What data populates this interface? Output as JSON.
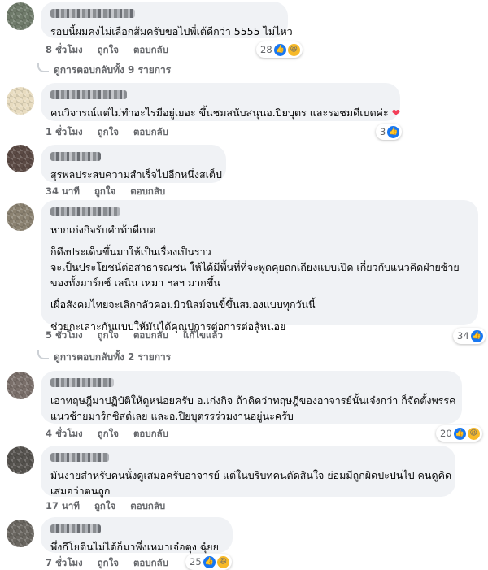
{
  "comments": [
    {
      "lines": [
        "รอบนี้ผมคงไม่เลือกส้มครับขอไปพี่เต้ดีกว่า 5555 ไม่ไหว"
      ],
      "time": "8 ชั่วโมง",
      "like": "ถูกใจ",
      "reply": "ตอบกลับ",
      "edited": "",
      "reaction_count": "28",
      "reactions": [
        "like-icon",
        "haha-icon"
      ],
      "avatar_color": "#6f7b6a"
    },
    {
      "lines": [
        "คนวิจารณ์แต่ไม่ทำอะไรมีอยู่เยอะ ขึ้นชมสนับสนุนอ.ปิยบุตร และรอชมดีเบตค่ะ"
      ],
      "time": "1 ชั่วโมง",
      "like": "ถูกใจ",
      "reply": "ตอบกลับ",
      "edited": "",
      "reaction_count": "3",
      "reactions": [
        "like-icon"
      ],
      "inline_icon": "heart-icon",
      "avatar_color": "#e8dcc0"
    },
    {
      "lines": [
        "สุรพลประสบความสำเร็จไปอีกหนึ่งสเต็ป"
      ],
      "time": "34 นาที",
      "like": "ถูกใจ",
      "reply": "ตอบกลับ",
      "edited": "",
      "reaction_count": "",
      "reactions": [],
      "avatar_color": "#5b4a44"
    },
    {
      "lines": [
        "หากเก่งกิจรับคำท้าดีเบต",
        "",
        "ก็ดึงประเด็นขึ้นมาให้เป็นเรื่องเป็นราว",
        "จะเป็นประโยชน์ต่อสาธารณชน ให้ได้มีพื้นที่ที่จะพูดคุยถกเถียงแบบเปิด เกี่ยวกับแนวคิดฝ่ายซ้าย",
        "ของทั้งมาร์กซ์ เลนิน เหมา ฯลฯ มากขึ้น",
        "",
        "เผื่อสังคมไทยจะเลิกกลัวคอมมิวนิสม์จนขี้ขึ้นสมองแบบทุกวันนี้",
        "",
        "ช่วยกะเลาะกันแบบให้มันได้คุณูปการต่อการต่อสู้หน่อย"
      ],
      "time": "5 ชั่วโมง",
      "like": "ถูกใจ",
      "reply": "ตอบกลับ",
      "edited": "แก้ไขแล้ว",
      "reaction_count": "34",
      "reactions": [
        "like-icon"
      ],
      "avatar_color": "#8a8170"
    },
    {
      "lines": [
        "เอาทฤษฎีมาปฏิบัติให้ดูหน่อยครับ อ.เก่งกิจ ถ้าคิดว่าทฤษฎีของอาจารย์นั้นเจ๋งกว่า ก็จัดตั้งพรรค",
        "แนวซ้ายมาร์กซิสต์เลย และอ.ปิยบุตรรร่วมงานอยู่นะครับ"
      ],
      "time": "4 ชั่วโมง",
      "like": "ถูกใจ",
      "reply": "ตอบกลับ",
      "edited": "",
      "reaction_count": "20",
      "reactions": [
        "like-icon",
        "haha-icon"
      ],
      "avatar_color": "#7a6f6a"
    },
    {
      "lines": [
        "มันง่ายสำหรับคนนั่งดูเสมอครับอาจารย์ แต่ในบริบทคนตัดสินใจ ย่อมมีถูกผิดปะปนไป คนดูคิด",
        "เสมอว่าตนถูก"
      ],
      "time": "17 นาที",
      "like": "ถูกใจ",
      "reply": "ตอบกลับ",
      "edited": "",
      "reaction_count": "",
      "reactions": [],
      "avatar_color": "#55524e"
    },
    {
      "lines": [
        "พึ่งกีโยตินไม่ได้ก็มาพึ่งเหมาเจ๋อตุง ฉุ๋ยย"
      ],
      "time": "7 ชั่วโมง",
      "like": "ถูกใจ",
      "reply": "ตอบกลับ",
      "edited": "",
      "reaction_count": "25",
      "reactions": [
        "like-icon",
        "haha-icon"
      ],
      "avatar_color": "#6a6660"
    }
  ],
  "view_replies": [
    {
      "label": "ดูการตอบกลับทั้ง 9 รายการ"
    },
    {
      "label": "ดูการตอบกลับทั้ง 2 รายการ"
    }
  ],
  "colors": {
    "bubble": "#f0f2f5",
    "meta": "#65676b",
    "like": "#1877f2",
    "haha": "#f7b928",
    "heart": "#f33e58"
  }
}
